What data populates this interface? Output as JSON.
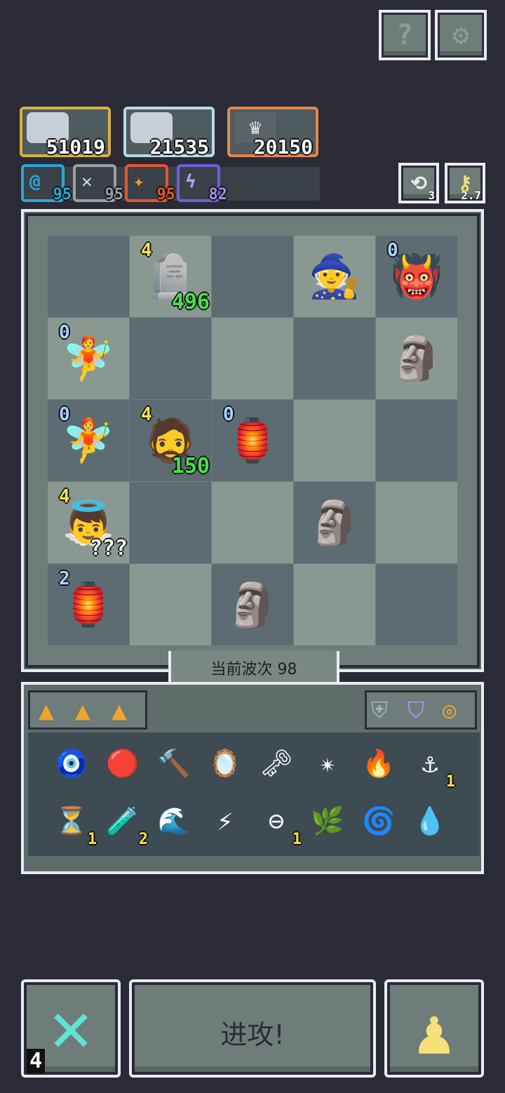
{
  "top_buttons": {
    "help_icon": "?",
    "settings_icon": "⚙"
  },
  "heroes": [
    {
      "value": "51019",
      "icon": "hero-portrait"
    },
    {
      "value": "21535",
      "icon": "hero-portrait"
    },
    {
      "value": "20150",
      "icon": "crown"
    }
  ],
  "stats": [
    {
      "icon": "@",
      "value": "95",
      "color": "#2aa7d6"
    },
    {
      "icon": "✕",
      "value": "95",
      "color": "#9aa19f"
    },
    {
      "icon": "✦",
      "value": "95",
      "color": "#e5552f"
    },
    {
      "icon": "ϟ",
      "value": "82",
      "color": "#8a63e0"
    }
  ],
  "counters": {
    "refresh_count": "3",
    "key_count": "2.7"
  },
  "board": {
    "units": [
      {
        "id": "u1",
        "emoji": "🪦",
        "level": "4",
        "hp": "496"
      },
      {
        "id": "u2",
        "emoji": "🧙",
        "level": "",
        "hp": ""
      },
      {
        "id": "u3",
        "emoji": "👹",
        "level": "0",
        "hp": ""
      },
      {
        "id": "u4",
        "emoji": "🧚",
        "level": "0",
        "hp": ""
      },
      {
        "id": "u5",
        "emoji": "🗿",
        "level": "",
        "hp": ""
      },
      {
        "id": "u6",
        "emoji": "🧚",
        "level": "0",
        "hp": ""
      },
      {
        "id": "u7",
        "emoji": "🧔",
        "level": "4",
        "hp": "150"
      },
      {
        "id": "u8",
        "emoji": "🏮",
        "level": "0",
        "hp": ""
      },
      {
        "id": "u9",
        "emoji": "👼",
        "level": "4",
        "hp": "???"
      },
      {
        "id": "u10",
        "emoji": "🗿",
        "level": "",
        "hp": ""
      },
      {
        "id": "u11",
        "emoji": "🏮",
        "level": "2",
        "hp": ""
      },
      {
        "id": "u12",
        "emoji": "🗿",
        "level": "",
        "hp": ""
      }
    ]
  },
  "wave": {
    "label": "当前波次 98"
  },
  "bag": {
    "tabs": [
      "▲",
      "▲",
      "▲"
    ],
    "categories": [
      "⛨",
      "⛉",
      "◎"
    ],
    "items": [
      {
        "emoji": "🧿",
        "count": ""
      },
      {
        "emoji": "🔴",
        "count": ""
      },
      {
        "emoji": "🔨",
        "count": ""
      },
      {
        "emoji": "🪞",
        "count": ""
      },
      {
        "emoji": "🗝",
        "count": ""
      },
      {
        "emoji": "✴",
        "count": ""
      },
      {
        "emoji": "🔥",
        "count": ""
      },
      {
        "emoji": "⚓",
        "count": "1"
      },
      {
        "emoji": "⏳",
        "count": "1"
      },
      {
        "emoji": "🧪",
        "count": "2"
      },
      {
        "emoji": "🌊",
        "count": ""
      },
      {
        "emoji": "⚡",
        "count": ""
      },
      {
        "emoji": "⊖",
        "count": "1"
      },
      {
        "emoji": "🌿",
        "count": ""
      },
      {
        "emoji": "🌀",
        "count": ""
      },
      {
        "emoji": "💧",
        "count": ""
      }
    ]
  },
  "bottom": {
    "moves_left": "4",
    "attack_label": "进攻!",
    "swords_icon": "✕",
    "pawn_icon": "♟"
  }
}
